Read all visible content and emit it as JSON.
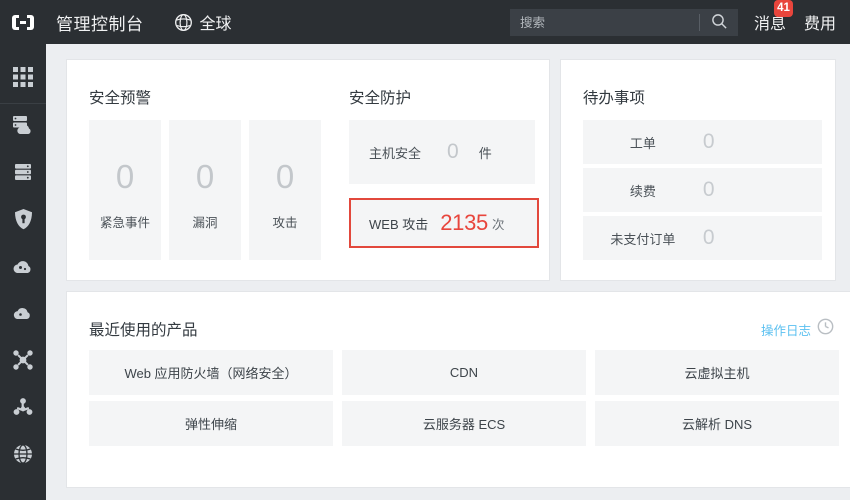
{
  "header": {
    "logo_name": "console-logo",
    "console_title": "管理控制台",
    "region_label": "全球",
    "search_placeholder": "搜索",
    "search_value": "",
    "messages_label": "消息",
    "messages_badge": "41",
    "billing_label": "费用"
  },
  "sidebar": {
    "items": [
      {
        "icon": "apps-grid-icon",
        "name": "sidebar-item-apps"
      },
      {
        "icon": "server-cloud-icon",
        "name": "sidebar-item-ecs"
      },
      {
        "icon": "database-icon",
        "name": "sidebar-item-database"
      },
      {
        "icon": "shield-icon",
        "name": "sidebar-item-security"
      },
      {
        "icon": "cloud-icon",
        "name": "sidebar-item-cloud-storage"
      },
      {
        "icon": "cloud-shape-icon",
        "name": "sidebar-item-cdn"
      },
      {
        "icon": "network-cross-icon",
        "name": "sidebar-item-network"
      },
      {
        "icon": "molecule-icon",
        "name": "sidebar-item-analytics"
      },
      {
        "icon": "globe-icon",
        "name": "sidebar-item-domains"
      }
    ]
  },
  "security_alert": {
    "title": "安全预警",
    "tiles": [
      {
        "value": "0",
        "label": "紧急事件"
      },
      {
        "value": "0",
        "label": "漏洞"
      },
      {
        "value": "0",
        "label": "攻击"
      }
    ]
  },
  "security_protection": {
    "title": "安全防护",
    "host_security": {
      "label": "主机安全",
      "value": "0",
      "unit": "件"
    },
    "web_attack": {
      "label": "WEB 攻击",
      "value": "2135",
      "unit": "次",
      "highlight_color": "#e2483c"
    }
  },
  "todo": {
    "title": "待办事项",
    "rows": [
      {
        "label": "工单",
        "value": "0"
      },
      {
        "label": "续费",
        "value": "0"
      },
      {
        "label": "未支付订单",
        "value": "0"
      }
    ]
  },
  "products": {
    "title": "最近使用的产品",
    "oplog_label": "操作日志",
    "tiles": [
      "Web 应用防火墙（网络安全）",
      "CDN",
      "云虚拟主机",
      "弹性伸缩",
      "云服务器 ECS",
      "云解析 DNS"
    ]
  }
}
